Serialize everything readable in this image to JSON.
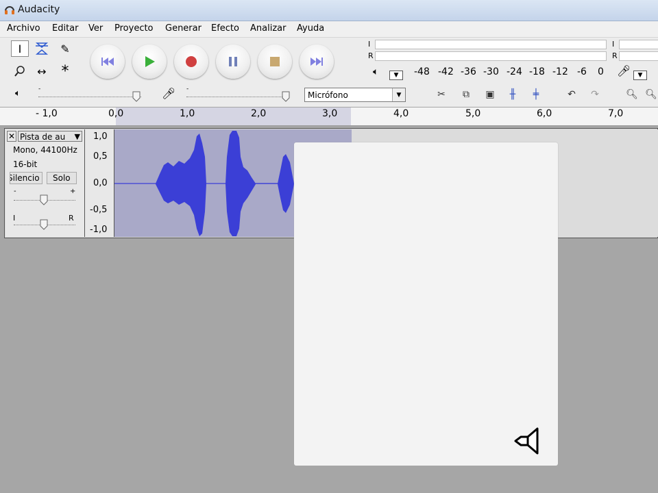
{
  "window": {
    "title": "Audacity"
  },
  "menu": [
    "Archivo",
    "Editar",
    "Ver",
    "Proyecto",
    "Generar",
    "Efecto",
    "Analizar",
    "Ayuda"
  ],
  "meter": {
    "left_channel": "I",
    "right_channel": "R",
    "scale": [
      "-48",
      "-42",
      "-36",
      "-30",
      "-24",
      "-18",
      "-12",
      "-6",
      "0"
    ]
  },
  "mixer": {
    "input_device": "Micrófono"
  },
  "ruler": {
    "ticks": [
      "- 1,0",
      "0,0",
      "1,0",
      "2,0",
      "3,0",
      "4,0",
      "5,0",
      "6,0",
      "7,0"
    ]
  },
  "track": {
    "name": "Pista de au",
    "info_rate": "Mono, 44100Hz",
    "info_bits": "16-bit",
    "mute": "Silencio",
    "solo": "Solo",
    "gain_minus": "-",
    "gain_plus": "+",
    "pan_left": "I",
    "pan_right": "R",
    "scale": [
      "1,0",
      "0,5",
      "0,0",
      "-0,5",
      "-1,0"
    ]
  },
  "colors": {
    "waveform": "#3b3fd6",
    "selection": "#a9a9c8",
    "play": "#3ab03a",
    "record": "#d04040",
    "stop": "#c8a870",
    "skip": "#8080e0"
  }
}
